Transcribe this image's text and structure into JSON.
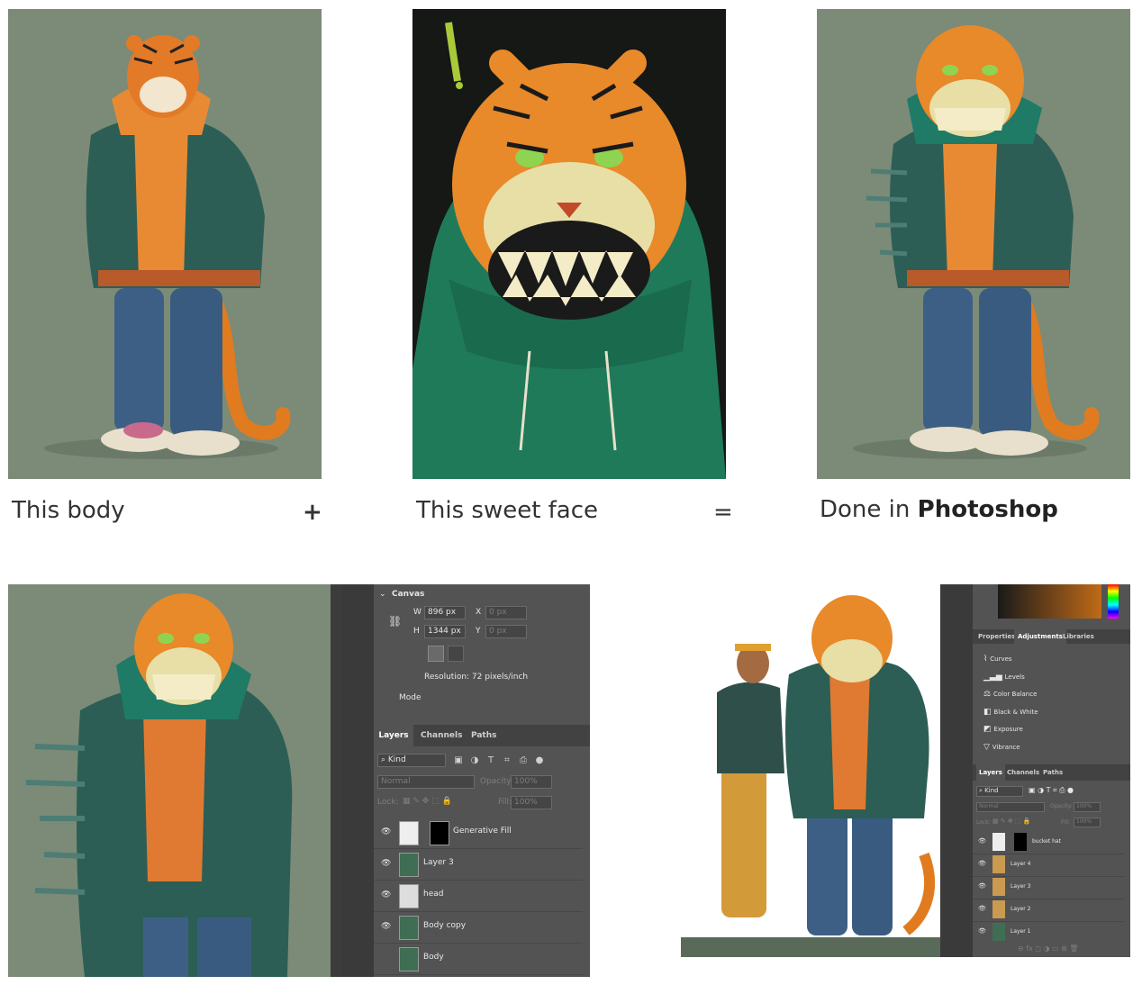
{
  "row1": {
    "caption1": "This body",
    "plus": "+",
    "caption2": "This sweet face",
    "equals": "=",
    "caption3_prefix": "Done in ",
    "caption3_bold": "Photoshop"
  },
  "panel_left": {
    "canvas_header": "Canvas",
    "w_label": "W",
    "w_value": "896 px",
    "h_label": "H",
    "h_value": "1344 px",
    "x_label": "X",
    "x_placeholder": "0 px",
    "y_label": "Y",
    "y_placeholder": "0 px",
    "resolution": "Resolution: 72 pixels/inch",
    "mode": "Mode",
    "tabs": [
      "Layers",
      "Channels",
      "Paths"
    ],
    "kind": "Kind",
    "blend": "Normal",
    "opacity_label": "Opacity:",
    "opacity_value": "100%",
    "lock_label": "Lock:",
    "fill_label": "Fill:",
    "fill_value": "100%",
    "layers": [
      "Generative Fill",
      "Layer 3",
      "head",
      "Body copy",
      "Body"
    ]
  },
  "panel_right": {
    "tabs": [
      "Properties",
      "Adjustments",
      "Libraries"
    ],
    "adjustments": [
      "Curves",
      "Levels",
      "Color Balance",
      "Black & White",
      "Exposure",
      "Vibrance"
    ],
    "layer_tabs": [
      "Layers",
      "Channels",
      "Paths"
    ],
    "kind": "Kind",
    "blend": "Normal",
    "opacity_label": "Opacity:",
    "opacity_value": "100%",
    "lock_label": "Lock:",
    "fill_label": "Fill:",
    "fill_value": "100%",
    "layers": [
      "bucket hat",
      "Layer 4",
      "Layer 3",
      "Layer 2",
      "Layer 1"
    ]
  },
  "colors": {
    "sage_bg": "#7b8b77",
    "dark_bg": "#151815",
    "ps_panel": "#535353",
    "tiger_orange": "#e8892a",
    "jacket_teal": "#2c5e55",
    "hoodie_green": "#1f7a5a"
  }
}
